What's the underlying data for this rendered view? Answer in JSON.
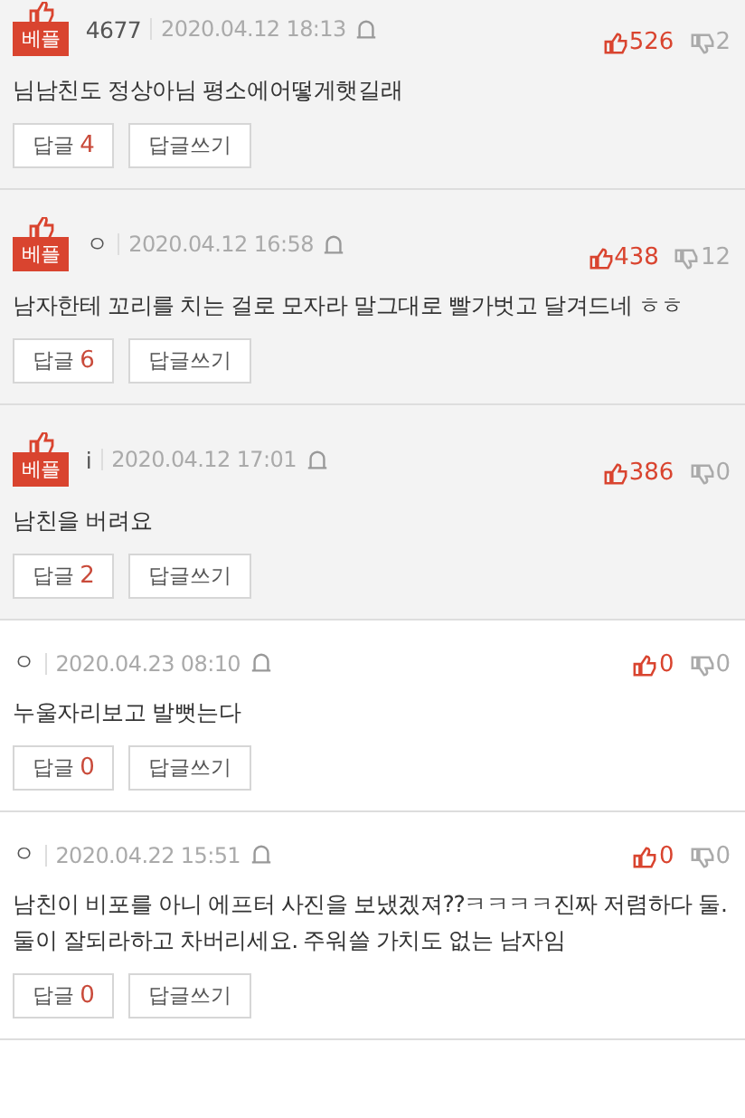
{
  "comments": [
    {
      "best": true,
      "badge": "베플",
      "author": "4677",
      "date": "2020.04.12 18:13",
      "likes": "526",
      "dislikes": "2",
      "text": "님남친도 정상아님 평소에어떻게햇길래",
      "reply_label": "답글",
      "reply_count": "4",
      "write_label": "답글쓰기"
    },
    {
      "best": true,
      "badge": "베플",
      "author": "ㅇ",
      "date": "2020.04.12 16:58",
      "likes": "438",
      "dislikes": "12",
      "text": "남자한테 꼬리를 치는 걸로 모자라 말그대로 빨가벗고 달겨드네 ㅎㅎ",
      "reply_label": "답글",
      "reply_count": "6",
      "write_label": "답글쓰기"
    },
    {
      "best": true,
      "badge": "베플",
      "author": "i",
      "date": "2020.04.12 17:01",
      "likes": "386",
      "dislikes": "0",
      "text": "남친을 버려요",
      "reply_label": "답글",
      "reply_count": "2",
      "write_label": "답글쓰기"
    },
    {
      "best": false,
      "author": "ㅇ",
      "date": "2020.04.23 08:10",
      "likes": "0",
      "dislikes": "0",
      "text": "누울자리보고 발뻣는다",
      "reply_label": "답글",
      "reply_count": "0",
      "write_label": "답글쓰기"
    },
    {
      "best": false,
      "author": "ㅇ",
      "date": "2020.04.22 15:51",
      "likes": "0",
      "dislikes": "0",
      "text": "남친이 비포를 아니 에프터 사진을 보냈겠져??ㅋㅋㅋㅋ진짜 저렴하다 둘. 둘이 잘되라하고 차버리세요. 주워쓸 가치도 없는 남자임",
      "reply_label": "답글",
      "reply_count": "0",
      "write_label": "답글쓰기"
    }
  ]
}
